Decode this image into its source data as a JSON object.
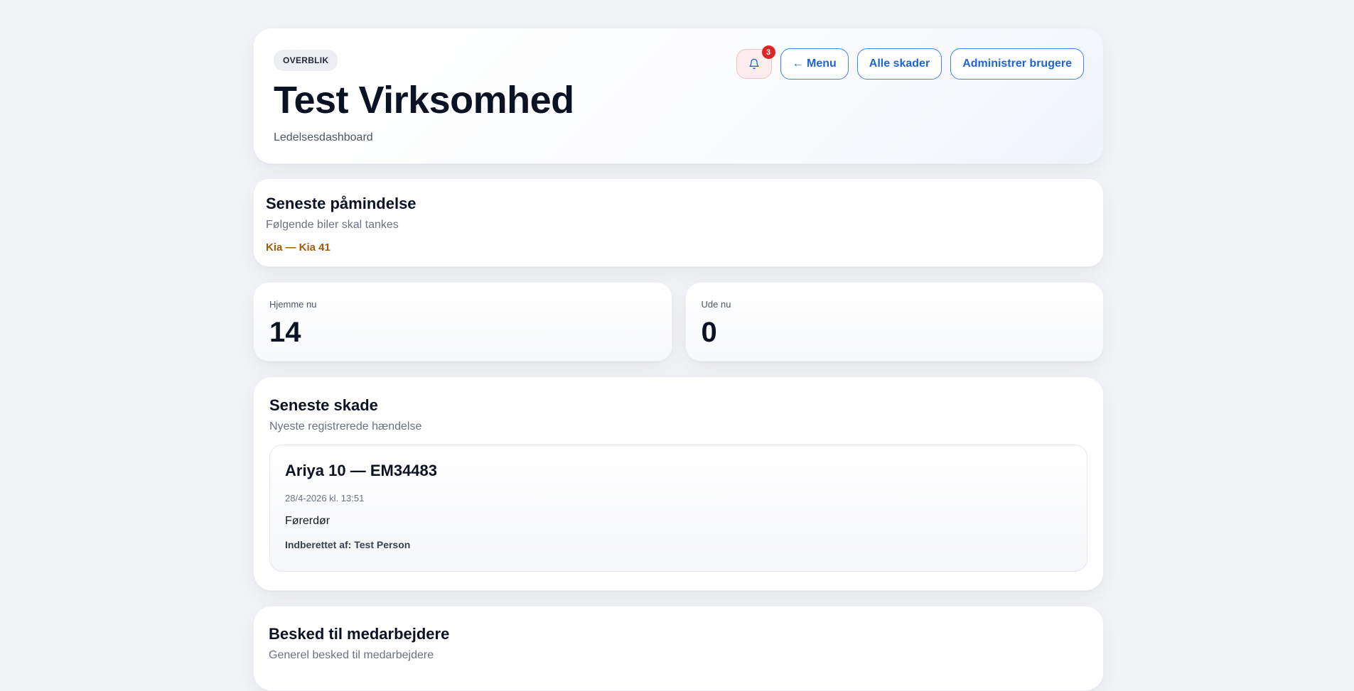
{
  "header": {
    "badge": "OVERBLIK",
    "title": "Test Virksomhed",
    "subtitle": "Ledelsesdashboard",
    "notification_count": "3",
    "menu_label": "← Menu",
    "all_damages_label": "Alle skader",
    "manage_users_label": "Administrer brugere"
  },
  "reminder": {
    "title": "Seneste påmindelse",
    "subtitle": "Følgende biler skal tankes",
    "item": "Kia — Kia 41"
  },
  "stats": {
    "home_label": "Hjemme nu",
    "home_value": "14",
    "out_label": "Ude nu",
    "out_value": "0"
  },
  "latest_damage": {
    "title": "Seneste skade",
    "subtitle": "Nyeste registrerede hændelse",
    "vehicle": "Ariya 10 — EM34483",
    "date": "28/4-2026 kl. 13:51",
    "part": "Førerdør",
    "reporter": "Indberettet af: Test Person"
  },
  "message": {
    "title": "Besked til medarbejdere",
    "subtitle": "Generel besked til medarbejdere"
  },
  "colors": {
    "accent": "#1d64d8",
    "reminder_text": "#a15c0a",
    "badge_red": "#dc2626"
  },
  "icons": {
    "notifications": "bell-icon"
  }
}
